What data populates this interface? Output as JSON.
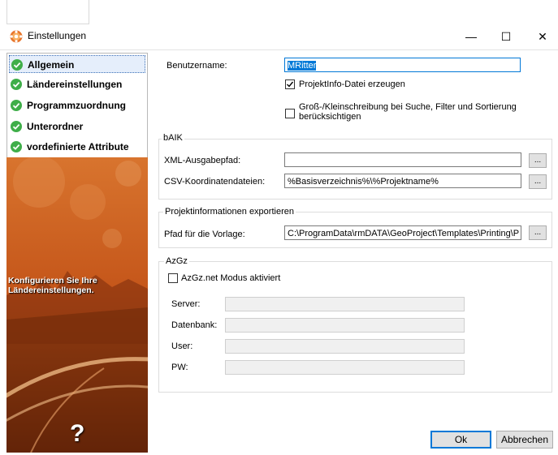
{
  "window": {
    "title": "Einstellungen",
    "minimize": "—",
    "maximize": "☐",
    "close": "✕"
  },
  "nav": {
    "items": [
      {
        "label": "Allgemein",
        "selected": true
      },
      {
        "label": "Ländereinstellungen",
        "selected": false
      },
      {
        "label": "Programmzuordnung",
        "selected": false
      },
      {
        "label": "Unterordner",
        "selected": false
      },
      {
        "label": "vordefinierte Attribute",
        "selected": false
      }
    ]
  },
  "banner": {
    "text_line1": "Konfigurieren Sie Ihre",
    "text_line2": "Ländereinstellungen.",
    "help": "?"
  },
  "general": {
    "username_label": "Benutzername:",
    "username_value": "MRitter",
    "projectinfo_label": "ProjektInfo-Datei erzeugen",
    "projectinfo_checked": true,
    "case_label_line1": "Groß-/Kleinschreibung bei Suche, Filter und Sortierung",
    "case_label_line2": "berücksichtigen",
    "case_checked": false
  },
  "baik": {
    "title": "bAIK",
    "xml_label": "XML-Ausgabepfad:",
    "xml_value": "",
    "csv_label": "CSV-Koordinatendateien:",
    "csv_value": "%Basisverzeichnis%\\%Projektname%",
    "browse": "..."
  },
  "export": {
    "title": "Projektinformationen exportieren",
    "template_label": "Pfad für die Vorlage:",
    "template_value": "C:\\ProgramData\\rmDATA\\GeoProject\\Templates\\Printing\\P",
    "browse": "..."
  },
  "azgz": {
    "title": "AzGz",
    "mode_label": "AzGz.net Modus aktiviert",
    "mode_checked": false,
    "server_label": "Server:",
    "db_label": "Datenbank:",
    "user_label": "User:",
    "pw_label": "PW:"
  },
  "buttons": {
    "ok": "Ok",
    "cancel": "Abbrechen"
  },
  "colors": {
    "check_green": "#3fae49",
    "accent": "#0078d7",
    "banner_orange": "#c5561a"
  }
}
